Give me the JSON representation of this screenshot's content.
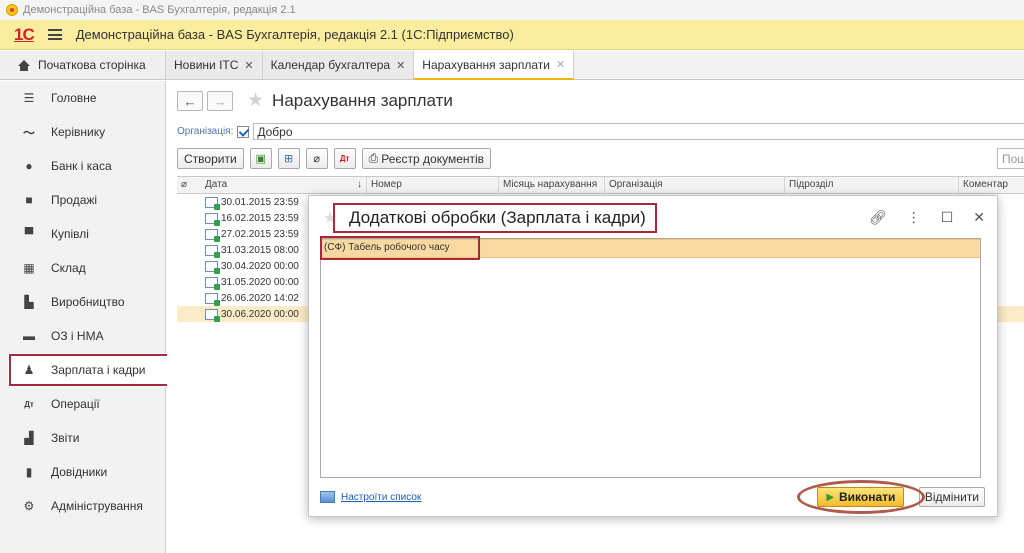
{
  "window_title": "Демонстраційна база - BAS Бухгалтерія, редакція 2.1",
  "app": {
    "logo": "1С",
    "title": "Демонстраційна база - BAS Бухгалтерія, редакція 2.1  (1С:Підприємство)"
  },
  "tabs": [
    {
      "label": "Початкова сторінка",
      "closable": false
    },
    {
      "label": "Новини ІТС",
      "closable": true
    },
    {
      "label": "Календар бухгалтера",
      "closable": true
    },
    {
      "label": "Нарахування зарплати",
      "closable": true,
      "active": true
    }
  ],
  "sidebar": {
    "items": [
      {
        "label": "Головне",
        "icon": "menu-lines-icon"
      },
      {
        "label": "Керівнику",
        "icon": "trend-icon"
      },
      {
        "label": "Банк і каса",
        "icon": "coin-icon"
      },
      {
        "label": "Продажі",
        "icon": "bag-icon"
      },
      {
        "label": "Купівлі",
        "icon": "cart-icon"
      },
      {
        "label": "Склад",
        "icon": "warehouse-icon"
      },
      {
        "label": "Виробництво",
        "icon": "factory-icon"
      },
      {
        "label": "ОЗ і НМА",
        "icon": "truck-icon"
      },
      {
        "label": "Зарплата і кадри",
        "icon": "person-icon",
        "selected": true
      },
      {
        "label": "Операції",
        "icon": "dt-kt-icon"
      },
      {
        "label": "Звіти",
        "icon": "bar-chart-icon"
      },
      {
        "label": "Довідники",
        "icon": "book-icon"
      },
      {
        "label": "Адміністрування",
        "icon": "gear-icon"
      }
    ]
  },
  "form": {
    "title": "Нарахування зарплати",
    "org_label": "Організація:",
    "org_value": "Добро",
    "create_label": "Створити",
    "registry_label": "Реєстр документів",
    "search_placeholder": "Пошу"
  },
  "grid": {
    "columns": [
      "Дата",
      "Номер",
      "Місяць нарахування",
      "Організація",
      "Підрозділ",
      "Коментар"
    ],
    "rows": [
      {
        "date": "30.01.2015 23:59"
      },
      {
        "date": "16.02.2015 23:59"
      },
      {
        "date": "27.02.2015 23:59"
      },
      {
        "date": "31.03.2015 08:00"
      },
      {
        "date": "30.04.2020 00:00"
      },
      {
        "date": "31.05.2020 00:00"
      },
      {
        "date": "26.06.2020 14:02"
      },
      {
        "date": "30.06.2020 00:00",
        "selected": true
      }
    ]
  },
  "dialog": {
    "title": "Додаткові обробки (Зарплата і кадри)",
    "items": [
      "(СФ) Табель робочого часу"
    ],
    "settings_link": "Настроїти список",
    "run_label": "Виконати",
    "cancel_label": "Відмінити"
  },
  "colors": {
    "accent_yellow": "#fbed9e",
    "highlight_red": "#a8283b",
    "selection_orange": "#f8d9a2",
    "link_blue": "#1f5fb5"
  }
}
